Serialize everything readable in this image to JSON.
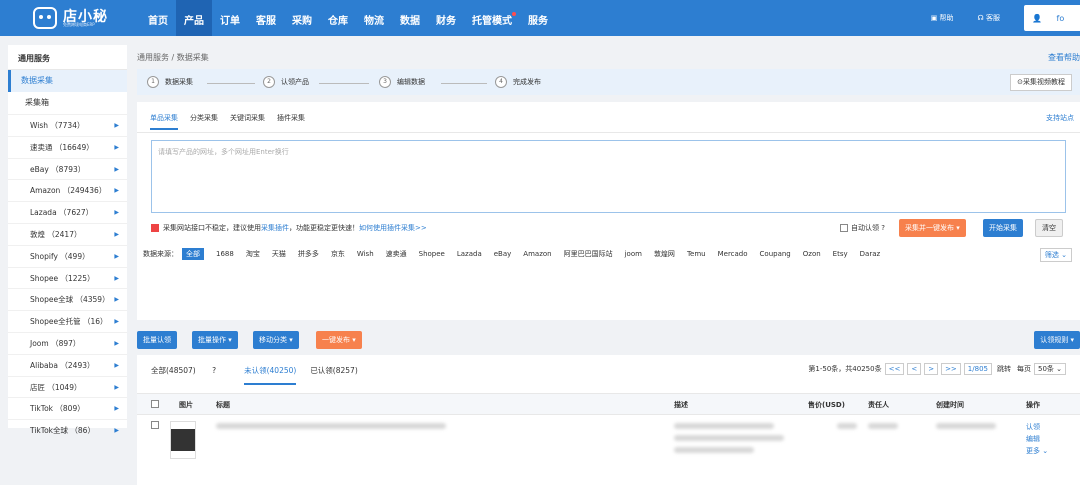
{
  "header": {
    "logo_name": "店小秘",
    "logo_sub": "免费跨境电商ERP",
    "nav": [
      "首页",
      "产品",
      "订单",
      "客服",
      "采购",
      "仓库",
      "物流",
      "数据",
      "财务",
      "托管模式",
      "服务"
    ],
    "help": "帮助",
    "service": "客服",
    "user": "fo"
  },
  "sidebar": {
    "title": "通用服务",
    "active": "数据采集",
    "sub": "采集箱",
    "items": [
      "Wish （7734）",
      "速卖通 （16649）",
      "eBay （8793）",
      "Amazon （249436）",
      "Lazada （7627）",
      "敦煌 （2417）",
      "Shopify （499）",
      "Shopee （1225）",
      "Shopee全球 （4359）",
      "Shopee全托管 （16）",
      "Joom （897）",
      "Alibaba （2493）",
      "店匠 （1049）",
      "TikTok （809）",
      "TikTok全球 （86）"
    ]
  },
  "breadcrumb": {
    "root": "通用服务",
    "sep": "/",
    "page": "数据采集",
    "help": "查看帮助"
  },
  "steps": [
    {
      "n": "1",
      "label": "数据采集"
    },
    {
      "n": "2",
      "label": "认领产品"
    },
    {
      "n": "3",
      "label": "编辑数据"
    },
    {
      "n": "4",
      "label": "完成发布"
    }
  ],
  "video_btn": "采集视频教程",
  "collect": {
    "tabs": [
      "单品采集",
      "分类采集",
      "关键词采集",
      "插件采集"
    ],
    "support": "支持站点",
    "placeholder": "请填写产品的网址，多个网址用Enter换行",
    "notice": "采集网站接口不稳定，建议使用",
    "notice_link": "采集插件",
    "notice2": "，功能更稳定更快速！",
    "notice_link2": "如何使用插件采集>>",
    "auto_claim": "自动认领",
    "btn_collect_publish": "采集并一键发布",
    "btn_start": "开始采集",
    "btn_clear": "清空",
    "source_label": "数据来源：",
    "sources": [
      "全部",
      "1688",
      "淘宝",
      "天猫",
      "拼多多",
      "京东",
      "Wish",
      "速卖通",
      "Shopee",
      "Lazada",
      "eBay",
      "Amazon",
      "阿里巴巴国际站",
      "joom",
      "敦煌网",
      "Temu",
      "Mercado",
      "Coupang",
      "Ozon",
      "Etsy",
      "Daraz"
    ],
    "filter": "筛选"
  },
  "actions": {
    "batch_claim": "批量认领",
    "batch_op": "批量操作",
    "move_cat": "移动分类",
    "one_click": "一键发布",
    "claim_rule": "认领规则"
  },
  "list": {
    "tabs": [
      "全部(48507)",
      "未认领(40250)",
      "已认领(8257)"
    ],
    "range": "第1-50条，共40250条",
    "pages": [
      "<<",
      "<",
      ">",
      ">>"
    ],
    "page_info": "1/805",
    "jump": "跳转",
    "per_page": "每页",
    "per_val": "50条",
    "headers": [
      "图片",
      "标题",
      "描述",
      "售价(USD)",
      "责任人",
      "创建时间",
      "操作"
    ],
    "ops": [
      "认领",
      "编辑",
      "更多"
    ]
  }
}
